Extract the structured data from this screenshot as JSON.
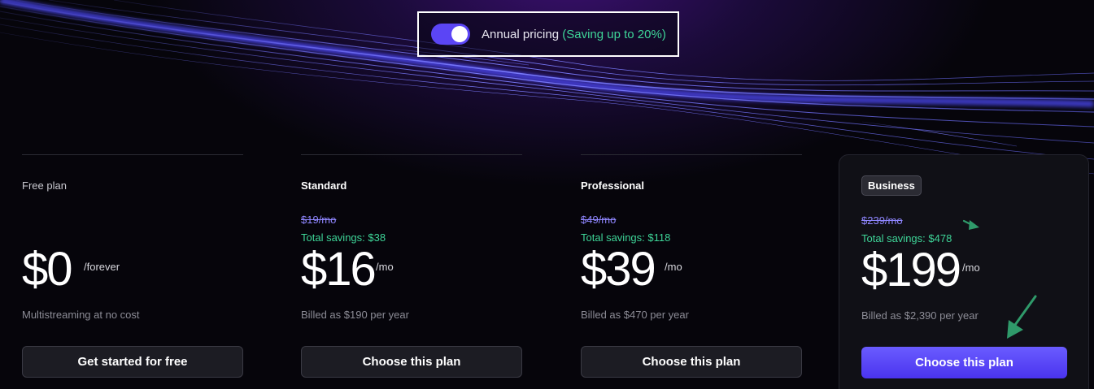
{
  "toggle": {
    "label": "Annual pricing",
    "saving": "(Saving up to 20%)",
    "enabled": true,
    "accent": "#5b45f5"
  },
  "plans": [
    {
      "name": "Free plan",
      "old_price": "",
      "savings": "",
      "price": "$0",
      "period": "/forever",
      "description": "Multistreaming at no cost",
      "cta": "Get started for free"
    },
    {
      "name": "Standard",
      "old_price": "$19/mo",
      "savings": "Total savings: $38",
      "price": "$16",
      "period": "/mo",
      "description": "Billed as $190 per year",
      "cta": "Choose this plan"
    },
    {
      "name": "Professional",
      "old_price": "$49/mo",
      "savings": "Total savings: $118",
      "price": "$39",
      "period": "/mo",
      "description": "Billed as $470 per year",
      "cta": "Choose this plan"
    },
    {
      "name": "Business",
      "old_price": "$239/mo",
      "savings": "Total savings: $478",
      "price": "$199",
      "period": "/mo",
      "description": "Billed as $2,390 per year",
      "cta": "Choose this plan"
    }
  ],
  "colors": {
    "savings_green": "#3ed598",
    "strike_purple": "#8f86ff",
    "primary_button": "#5b45f5",
    "annotation_arrow": "#2f9a6a"
  },
  "icons": {
    "annotation": "arrow-icon"
  }
}
